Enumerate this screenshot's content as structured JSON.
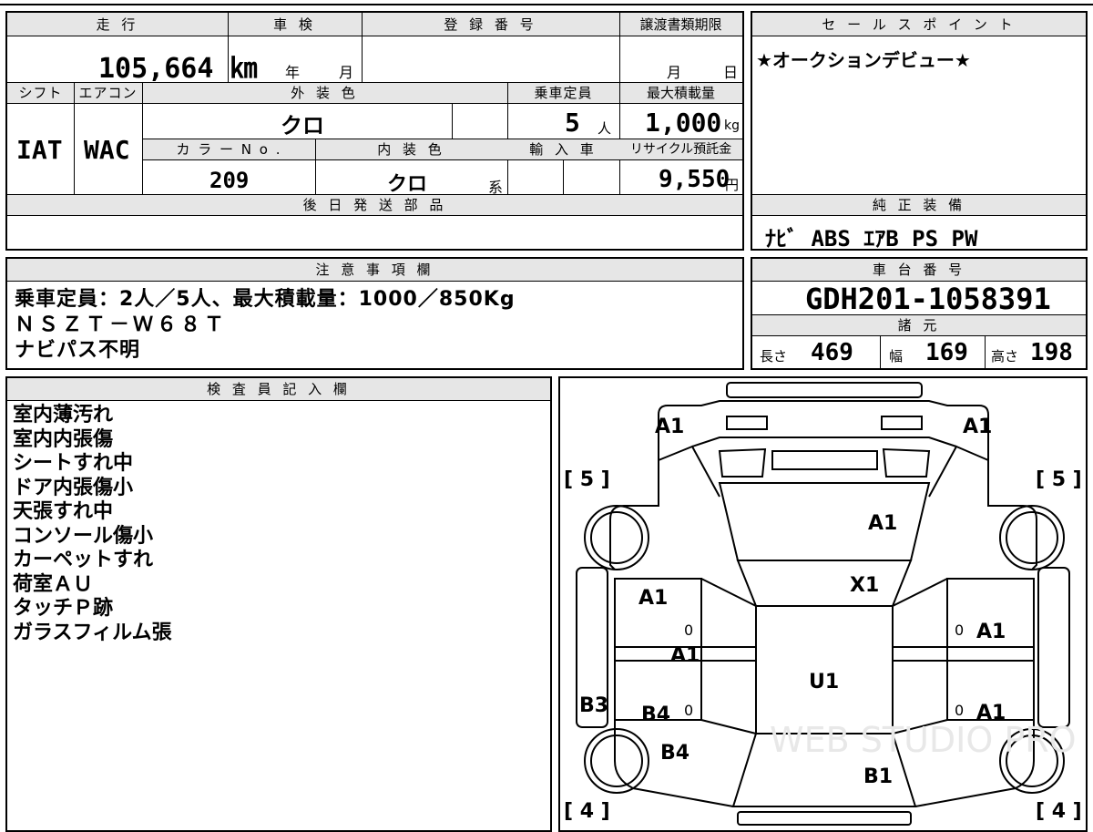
{
  "top_table": {
    "mileage_label": "走 行",
    "mileage_value": "105,664 ㎞",
    "inspection_label": "車 検",
    "inspection_year_unit": "年",
    "inspection_month_unit": "月",
    "registration_label": "登 録 番 号",
    "transfer_deadline_label": "譲渡書類期限",
    "transfer_month_unit": "月",
    "transfer_day_unit": "日",
    "shift_label": "シフト",
    "shift_value": "IAT",
    "aircon_label": "エアコン",
    "aircon_value": "WAC",
    "exterior_color_label": "外 装 色",
    "exterior_color_value": "クロ",
    "capacity_label": "乗車定員",
    "capacity_value": "5",
    "capacity_unit": "人",
    "max_load_label": "最大積載量",
    "max_load_value": "1,000",
    "max_load_unit": "kg",
    "color_no_label": "カ ラ ー N o .",
    "color_no_value": "209",
    "interior_color_label": "内 装 色",
    "interior_color_value": "クロ",
    "interior_color_suffix": "系",
    "import_label": "輸 入 車",
    "recycle_label": "リサイクル預託金",
    "recycle_value": "9,550",
    "recycle_unit": "円",
    "later_parts_label": "後 日 発 送 部 品"
  },
  "sales_point": {
    "label": "セ ー ル ス ポ イ ン ト",
    "text": "★オークションデビュー★"
  },
  "genuine_equipment": {
    "label": "純 正 装 備",
    "text": "ﾅﾋﾞ ABS ｴｱB PS PW"
  },
  "notes": {
    "label": "注 意 事 項 欄",
    "lines": [
      "乗車定員：2人／5人、最大積載量：1000／850Kg",
      "ＮＳＺＴ－Ｗ６８Ｔ",
      "ナビパス不明"
    ]
  },
  "chassis": {
    "label": "車 台 番 号",
    "value": "GDH201-1058391"
  },
  "specs": {
    "label": "諸 元",
    "length_label": "長さ",
    "length_value": "469",
    "width_label": "幅",
    "width_value": "169",
    "height_label": "高さ",
    "height_value": "198"
  },
  "inspector": {
    "label": "検 査 員 記 入 欄",
    "lines": [
      "室内薄汚れ",
      "室内内張傷",
      "シートすれ中",
      "ドア内張傷小",
      "天張すれ中",
      "コンソール傷小",
      "カーペットすれ",
      "荷室ＡＵ",
      "タッチＰ跡",
      "ガラスフィルム張"
    ]
  },
  "diagram": {
    "tire_front_left": "[ 5 ]",
    "tire_front_right": "[ 5 ]",
    "tire_rear_left": "[ 4 ]",
    "tire_rear_right": "[ 4 ]",
    "marks": {
      "front_left_corner": "A1",
      "front_right_corner": "A1",
      "hood": "A1",
      "windshield": "X1",
      "left_front_door": "A1",
      "left_pillar": "A1",
      "right_front_door": "A1",
      "right_rear_door": "A1",
      "left_rear_door": "B4",
      "left_rear_quarter": "B4",
      "left_rocker": "B3",
      "roof": "U1",
      "tailgate": "B1",
      "zero_1": "0",
      "zero_2": "0",
      "zero_3": "0",
      "zero_4": "0"
    },
    "watermark": "WEB STUDIO PRO"
  }
}
